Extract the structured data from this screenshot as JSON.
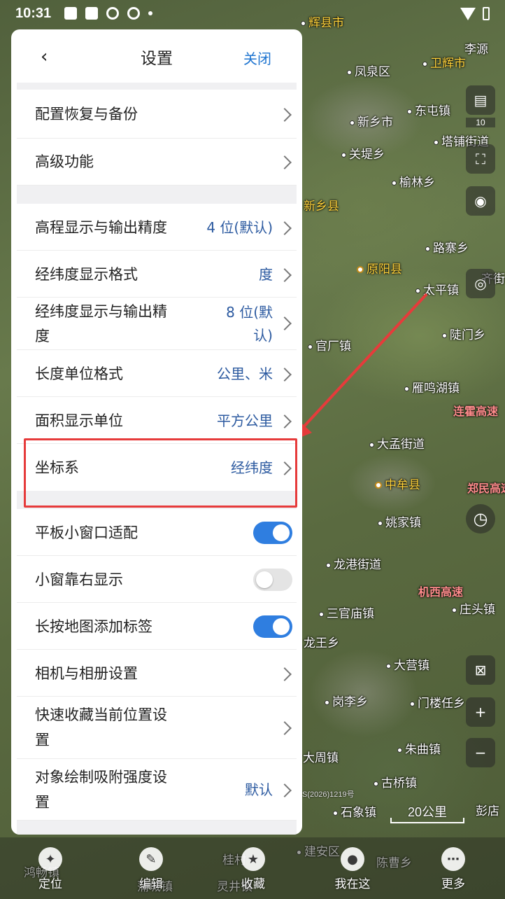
{
  "status_bar": {
    "time": "10:31"
  },
  "panel": {
    "title": "设置",
    "close_label": "关闭",
    "groups": [
      [
        {
          "label": "配置恢复与备份",
          "value": ""
        },
        {
          "label": "高级功能",
          "value": ""
        }
      ],
      [
        {
          "label": "高程显示与输出精度",
          "value": "4 位(默认)"
        },
        {
          "label": "经纬度显示格式",
          "value": "度"
        },
        {
          "label": "经纬度显示与输出精度",
          "value": "8 位(默认)"
        },
        {
          "label": "长度单位格式",
          "value": "公里、米"
        },
        {
          "label": "面积显示单位",
          "value": "平方公里"
        },
        {
          "label": "坐标系",
          "value": "经纬度"
        }
      ],
      [
        {
          "label": "平板小窗口适配",
          "toggle": true
        },
        {
          "label": "小窗靠右显示",
          "toggle": false
        },
        {
          "label": "长按地图添加标签",
          "toggle": true
        },
        {
          "label": "相机与相册设置",
          "value": ""
        },
        {
          "label": "快速收藏当前位置设置",
          "value": ""
        },
        {
          "label": "对象绘制吸附强度设置",
          "value": "默认"
        }
      ]
    ],
    "row_labels_wrapped": {
      "lat_precision": [
        "经纬度显示与输出精",
        "度"
      ],
      "lat_precision_value": [
        "8 位(默",
        "认)"
      ],
      "quick_fav": [
        "快速收藏当前位置设",
        "置"
      ],
      "snap": [
        "对象绘制吸附强度设",
        "置"
      ]
    }
  },
  "map": {
    "labels": [
      {
        "text": "辉县市",
        "kind": "county"
      },
      {
        "text": "凤泉区",
        "kind": "town"
      },
      {
        "text": "卫辉市",
        "kind": "county"
      },
      {
        "text": "李源",
        "kind": "town"
      },
      {
        "text": "新乡市",
        "kind": "town"
      },
      {
        "text": "东屯镇",
        "kind": "town"
      },
      {
        "text": "塔铺街道",
        "kind": "town"
      },
      {
        "text": "关堤乡",
        "kind": "town"
      },
      {
        "text": "榆林乡",
        "kind": "town"
      },
      {
        "text": "新乡县",
        "kind": "county"
      },
      {
        "text": "路寨乡",
        "kind": "town"
      },
      {
        "text": "原阳县",
        "kind": "county"
      },
      {
        "text": "太平镇",
        "kind": "town"
      },
      {
        "text": "齐街",
        "kind": "town"
      },
      {
        "text": "官厂镇",
        "kind": "town"
      },
      {
        "text": "陡门乡",
        "kind": "town"
      },
      {
        "text": "雁鸣湖镇",
        "kind": "town"
      },
      {
        "text": "连霍高速",
        "kind": "road"
      },
      {
        "text": "大孟街道",
        "kind": "town"
      },
      {
        "text": "中牟县",
        "kind": "county"
      },
      {
        "text": "郑民高速",
        "kind": "road"
      },
      {
        "text": "姚家镇",
        "kind": "town"
      },
      {
        "text": "龙港街道",
        "kind": "town"
      },
      {
        "text": "机西高速",
        "kind": "road"
      },
      {
        "text": "三官庙镇",
        "kind": "town"
      },
      {
        "text": "庄头镇",
        "kind": "town"
      },
      {
        "text": "龙王乡",
        "kind": "town"
      },
      {
        "text": "大营镇",
        "kind": "town"
      },
      {
        "text": "岗李乡",
        "kind": "town"
      },
      {
        "text": "门楼任乡",
        "kind": "town"
      },
      {
        "text": "朱曲镇",
        "kind": "town"
      },
      {
        "text": "大周镇",
        "kind": "town"
      },
      {
        "text": "古桥镇",
        "kind": "town"
      },
      {
        "text": "石象镇",
        "kind": "town"
      },
      {
        "text": "彭店",
        "kind": "town"
      },
      {
        "text": "建安区",
        "kind": "town"
      },
      {
        "text": "陈曹乡",
        "kind": "town"
      },
      {
        "text": "鸿畅镇",
        "kind": "town"
      },
      {
        "text": "灵井镇",
        "kind": "town"
      },
      {
        "text": "蒲城镇",
        "kind": "town"
      },
      {
        "text": "桂村",
        "kind": "town"
      }
    ],
    "layer_count": "10",
    "scale": "20公里",
    "copyright": "S(2026)1219号"
  },
  "bottom_nav": [
    {
      "label": "定位",
      "icon": "compass-icon"
    },
    {
      "label": "编辑",
      "icon": "pencil-icon"
    },
    {
      "label": "收藏",
      "icon": "star-icon"
    },
    {
      "label": "我在这",
      "icon": "location-pin-icon"
    },
    {
      "label": "更多",
      "icon": "more-icon"
    }
  ],
  "colors": {
    "accent": "#2f7ee0",
    "link": "#1e74d0",
    "value": "#2c5aa0",
    "highlight": "#e63b3b"
  }
}
